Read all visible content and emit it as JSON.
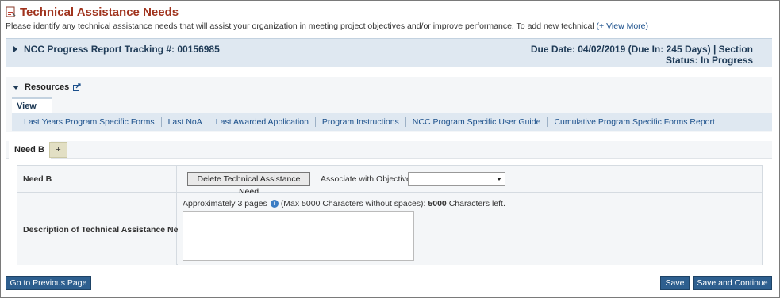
{
  "page": {
    "title": "Technical Assistance Needs",
    "instructions": "Please identify any technical assistance needs that will assist your organization in meeting project objectives and/or improve performance. To add new technical",
    "view_more": "(+ View More)"
  },
  "tracking": {
    "title": "NCC Progress Report Tracking #: 00156985",
    "due_line1": "Due Date: 04/02/2019 (Due In: 245 Days) | Section",
    "due_line2": "Status: In Progress"
  },
  "resources": {
    "title": "Resources",
    "view_tab": "View",
    "links": [
      "Last Years Program Specific Forms",
      "Last NoA",
      "Last Awarded Application",
      "Program Instructions",
      "NCC Program Specific User Guide",
      "Cumulative Program Specific Forms Report"
    ]
  },
  "tabs": {
    "active": "Need B",
    "add": "+"
  },
  "form": {
    "need_label": "Need B",
    "delete_button": "Delete Technical Assistance Need",
    "associate_label": "Associate with Objectives",
    "associate_value": "",
    "description_label": "Description of Technical Assistance Need",
    "approx_prefix": "Approximately 3 pages",
    "approx_mid": "(Max 5000 Characters without spaces):",
    "chars_left": "5000",
    "approx_suffix": "Characters left.",
    "description_value": ""
  },
  "footer": {
    "prev_button": "Go to Previous Page",
    "save_button": "Save",
    "save_continue_button": "Save and Continue"
  },
  "colors": {
    "title": "#a0331d",
    "header_bar": "#dfe8f1",
    "button_blue": "#2e5f8f",
    "link": "#1a4f8b"
  }
}
